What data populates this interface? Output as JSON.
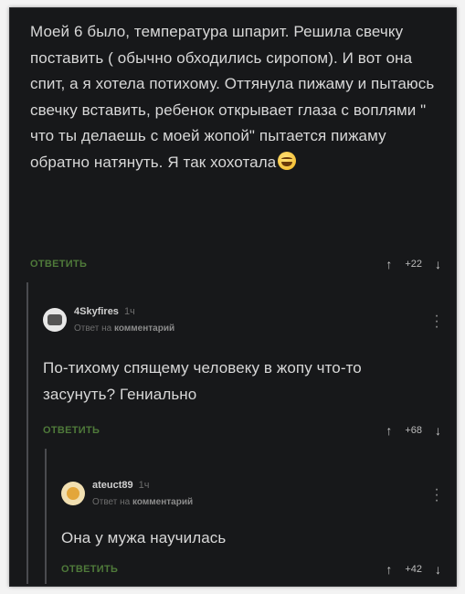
{
  "comments": [
    {
      "text": "Моей 6 было, температура шпарит. Решила свечку поставить ( обычно обходились сиропом). И вот она спит, а я хотела потихому. Оттянула пижаму и пытаюсь свечку вставить, ребенок открывает глаза с воплями \" что ты делаешь с моей жопой\" пытается пижаму обратно натянуть. Я так хохотала",
      "emoji": "grinning-sweat-emoji",
      "reply_label": "ОТВЕТИТЬ",
      "score": "+22",
      "up_icon": "↑",
      "down_icon": "↓"
    },
    {
      "username": "4Skyfires",
      "time": "1ч",
      "reply_to_prefix": "Ответ на",
      "reply_to_target": "комментарий",
      "text": "По-тихому спящему человеку в жопу что-то засунуть? Гениально",
      "reply_label": "ОТВЕТИТЬ",
      "score": "+68",
      "up_icon": "↑",
      "down_icon": "↓"
    },
    {
      "username": "ateuct89",
      "time": "1ч",
      "reply_to_prefix": "Ответ на",
      "reply_to_target": "комментарий",
      "text": "Она у мужа научилась",
      "reply_label": "ОТВЕТИТЬ",
      "score": "+42",
      "up_icon": "↑",
      "down_icon": "↓"
    }
  ],
  "colors": {
    "background": "#17181a",
    "text": "#d8d8d8",
    "reply_link": "#4f7a3a",
    "thread_line": "#4a4b4f"
  }
}
